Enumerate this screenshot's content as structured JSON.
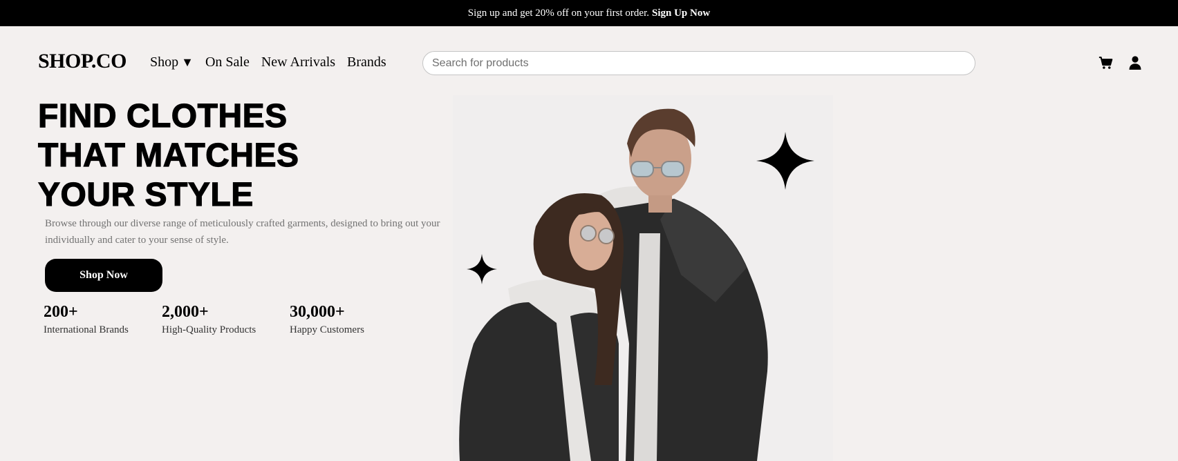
{
  "announcement": {
    "text": "Sign up and get 20% off on your first order.",
    "link": "Sign Up Now"
  },
  "header": {
    "logo": "SHOP.CO",
    "nav": [
      {
        "label": "Shop",
        "caret": "▼"
      },
      {
        "label": "On Sale"
      },
      {
        "label": "New Arrivals"
      },
      {
        "label": "Brands"
      }
    ],
    "search_placeholder": "Search for products",
    "icons": [
      "cart-icon",
      "user-icon"
    ]
  },
  "hero": {
    "title_lines": [
      "FIND CLOTHES",
      "THAT MATCHES",
      "YOUR STYLE"
    ],
    "description": "Browse through our diverse range of meticulously crafted garments, designed to bring out your individually and cater to your sense of style.",
    "cta": "Shop Now",
    "stats": [
      {
        "value": "200+",
        "label": "International Brands"
      },
      {
        "value": "2,000+",
        "label": "High-Quality Products"
      },
      {
        "value": "30,000+",
        "label": "Happy Customers"
      }
    ]
  },
  "colors": {
    "background": "#f3f0ef",
    "primary": "#000000",
    "muted_text": "#737373",
    "denim": "#2b2b2b",
    "hoodie": "#e6e4e2"
  }
}
